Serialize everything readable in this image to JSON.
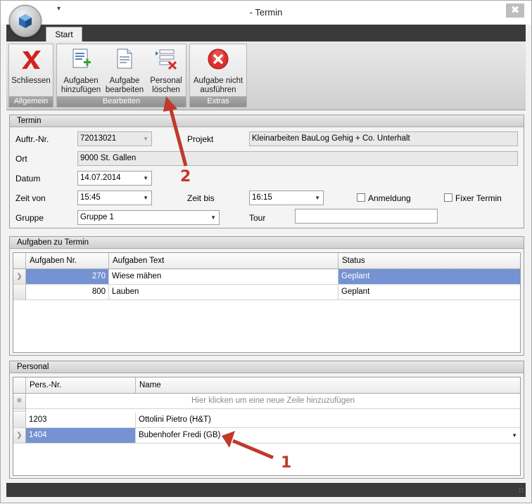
{
  "window": {
    "title": "- Termin",
    "qat_glyph": "▾",
    "close_glyph": "✖"
  },
  "ribbon": {
    "tabs": [
      {
        "label": "Start"
      }
    ],
    "groups": [
      {
        "label": "Allgemein",
        "buttons": [
          {
            "label": "Schliessen",
            "icon": "close-x-icon"
          }
        ]
      },
      {
        "label": "Bearbeiten",
        "buttons": [
          {
            "label": "Aufgaben hinzufügen",
            "icon": "add-task-icon"
          },
          {
            "label": "Aufgabe bearbeiten",
            "icon": "edit-task-icon"
          },
          {
            "label": "Personal löschen",
            "icon": "delete-personnel-icon"
          }
        ]
      },
      {
        "label": "Extras",
        "buttons": [
          {
            "label": "Aufgabe nicht ausführen",
            "icon": "cancel-task-icon"
          }
        ]
      }
    ]
  },
  "termin": {
    "title": "Termin",
    "auftr_label": "Auftr.-Nr.",
    "auftr_value": "72013021",
    "projekt_label": "Projekt",
    "projekt_value": "Kleinarbeiten BauLog Gehig + Co. Unterhalt",
    "ort_label": "Ort",
    "ort_value": "9000 St. Gallen",
    "datum_label": "Datum",
    "datum_value": "14.07.2014",
    "zeit_von_label": "Zeit von",
    "zeit_von_value": "15:45",
    "zeit_bis_label": "Zeit bis",
    "zeit_bis_value": "16:15",
    "anmeldung_label": "Anmeldung",
    "anmeldung_checked": false,
    "fixer_label": "Fixer Termin",
    "fixer_checked": false,
    "gruppe_label": "Gruppe",
    "gruppe_value": "Gruppe 1",
    "tour_label": "Tour",
    "tour_value": ""
  },
  "aufgaben": {
    "title": "Aufgaben zu Termin",
    "columns": [
      "Aufgaben Nr.",
      "Aufgaben Text",
      "Status"
    ],
    "rows": [
      {
        "nr": "270",
        "text": "Wiese mähen",
        "status": "Geplant",
        "selected": true
      },
      {
        "nr": "800",
        "text": "Lauben",
        "status": "Geplant",
        "selected": false
      }
    ]
  },
  "personal": {
    "title": "Personal",
    "columns": [
      "Pers.-Nr.",
      "Name"
    ],
    "new_row_hint": "Hier klicken um eine neue Zeile hinzuzufügen",
    "rows": [
      {
        "nr": "1203",
        "name": "Ottolini Pietro (H&T)",
        "selected": false
      },
      {
        "nr": "1404",
        "name": "Bubenhofer Fredi (GB)",
        "selected": true
      }
    ]
  },
  "annotations": {
    "marker_1": "1",
    "marker_2": "2",
    "color": "#c0392b"
  },
  "colors": {
    "selection": "#7592d2",
    "dark_bar": "#3a3a3a",
    "window_bg": "#f2f2f2"
  }
}
